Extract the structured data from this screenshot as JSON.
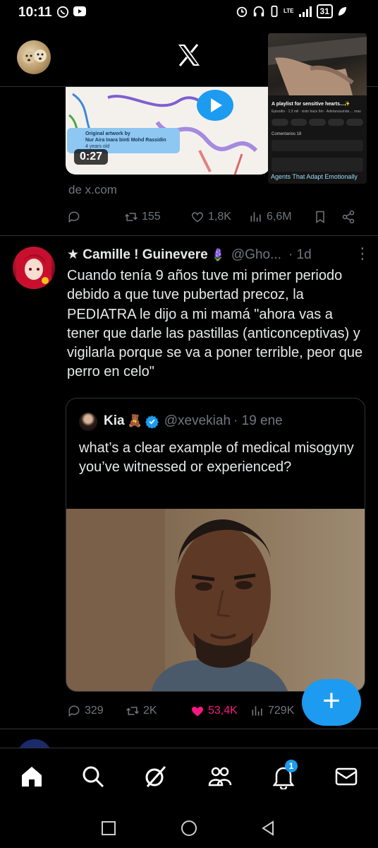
{
  "status_bar": {
    "time": "10:11",
    "battery": "31",
    "network": "LTE"
  },
  "header": {
    "logo": "x-logo-icon"
  },
  "pip": {
    "title": "A playlist for sensitive hearts...✨",
    "subtitle": "Episodio · 1:3 mil · visto hace 6m · Adetarsaumda ... mas",
    "comments_label": "Comentarios 18",
    "agents_label": "Agents That Adapt Emotionally"
  },
  "previous_tweet": {
    "art_caption_line1": "Original artwork by",
    "art_caption_line2": "Nur Aira Inara binti Mohd Rassidin",
    "art_caption_line3": "4 years old",
    "video_time": "0:27",
    "link_source": "de x.com",
    "actions": {
      "replies": "",
      "retweets": "155",
      "likes": "1,8K",
      "views": "6,6M"
    }
  },
  "tweet": {
    "display_name": "★ Camille ! Guinevere",
    "emoji": "🪻",
    "handle": "@Gho...",
    "time": "· 1d",
    "text": "Cuando tenía 9 años tuve mi primer periodo debido a que tuve pubertad precoz, la PEDIATRA le dijo a mi mamá \"ahora vas a tener que darle las pastillas (anticonceptivas) y vigilarla porque se va a poner terrible, peor que perro en celo\"",
    "quote": {
      "display_name": "Kia",
      "emoji": "🧸",
      "handle": "@xevekiah",
      "time": "· 19 ene",
      "text": "what’s a clear example of medical misogyny you’ve witnessed or experienced?"
    },
    "actions": {
      "replies": "329",
      "retweets": "2K",
      "likes": "53,4K",
      "views": "729K"
    }
  },
  "fab": {
    "label": "+"
  },
  "bottom_nav": {
    "items": [
      "home-icon",
      "search-icon",
      "grok-icon",
      "communities-icon",
      "notifications-icon",
      "messages-icon"
    ],
    "notification_count": "1"
  },
  "colors": {
    "accent": "#1d9bf0",
    "like": "#f91880",
    "muted": "#71767b",
    "divider": "#2f3336"
  }
}
